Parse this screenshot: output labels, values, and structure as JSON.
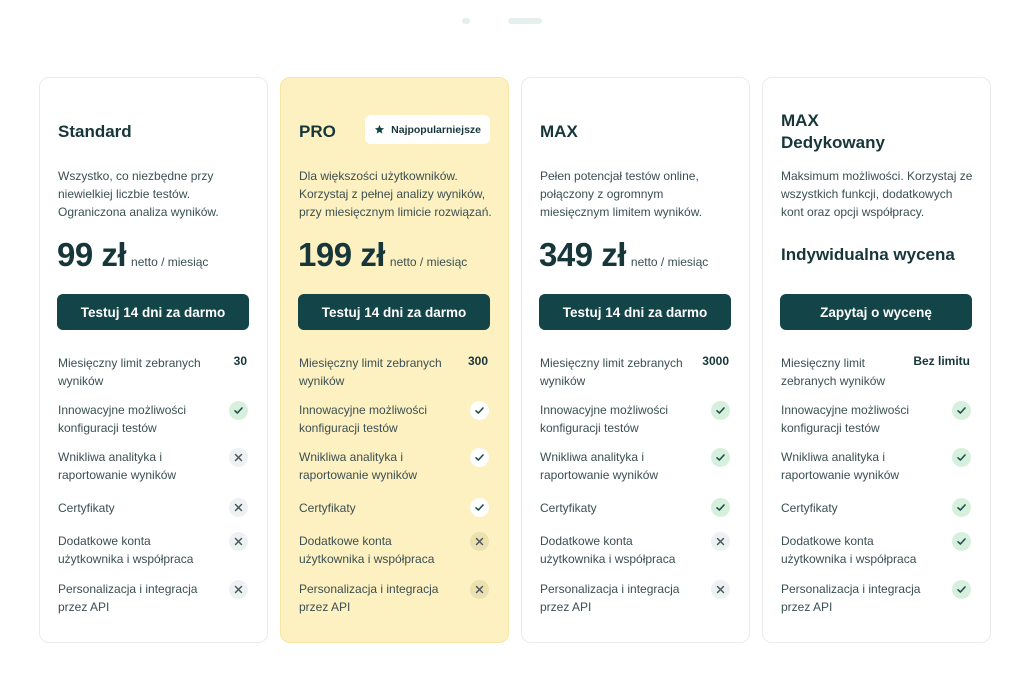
{
  "colors": {
    "primary": "#134447",
    "pro_background": "#fdf1c1",
    "check_background": "#d7f0de",
    "cross_background": "#eef1f2",
    "check_mark": "#1f4f4b"
  },
  "icons": {
    "included": "check-icon",
    "excluded": "cross-icon",
    "badge": "star-icon"
  },
  "plans": [
    {
      "id": "standard",
      "title_lines": [
        "Standard"
      ],
      "badge": "",
      "description": [
        "Wszystko, co niezbędne przy",
        "niewielkiej liczbie testów.",
        "Ograniczona analiza wyników."
      ],
      "price_amount": "99 zł",
      "price_unit": "netto / miesiąc",
      "custom_price": "",
      "cta": "Testuj 14 dni za darmo",
      "features": [
        {
          "label": [
            "Miesięczny limit zebranych",
            "wyników"
          ],
          "value": "30"
        },
        {
          "label": [
            "Innowacyjne możliwości",
            "konfiguracji testów"
          ],
          "included": true
        },
        {
          "label": [
            "Wnikliwa analityka i",
            "raportowanie wyników"
          ],
          "included": false
        },
        {
          "label": [
            "Certyfikaty"
          ],
          "included": false
        },
        {
          "label": [
            "Dodatkowe konta",
            "użytkownika i współpraca"
          ],
          "included": false
        },
        {
          "label": [
            "Personalizacja i integracja",
            "przez API"
          ],
          "included": false
        }
      ]
    },
    {
      "id": "pro",
      "title_lines": [
        "PRO"
      ],
      "badge": "Najpopularniejsze",
      "description": [
        "Dla większości użytkowników.",
        "Korzystaj z pełnej analizy wyników,",
        "przy miesięcznym limicie rozwiązań."
      ],
      "price_amount": "199 zł",
      "price_unit": "netto / miesiąc",
      "custom_price": "",
      "cta": "Testuj 14 dni za darmo",
      "features": [
        {
          "label": [
            "Miesięczny limit zebranych",
            "wyników"
          ],
          "value": "300"
        },
        {
          "label": [
            "Innowacyjne możliwości",
            "konfiguracji testów"
          ],
          "included": true
        },
        {
          "label": [
            "Wnikliwa analityka i",
            "raportowanie wyników"
          ],
          "included": true
        },
        {
          "label": [
            "Certyfikaty"
          ],
          "included": true
        },
        {
          "label": [
            "Dodatkowe konta",
            "użytkownika i współpraca"
          ],
          "included": false
        },
        {
          "label": [
            "Personalizacja i integracja",
            "przez API"
          ],
          "included": false
        }
      ]
    },
    {
      "id": "max",
      "title_lines": [
        "MAX"
      ],
      "badge": "",
      "description": [
        "Pełen potencjał testów online,",
        "połączony z ogromnym",
        "miesięcznym limitem wyników."
      ],
      "price_amount": "349 zł",
      "price_unit": "netto / miesiąc",
      "custom_price": "",
      "cta": "Testuj 14 dni za darmo",
      "features": [
        {
          "label": [
            "Miesięczny limit zebranych",
            "wyników"
          ],
          "value": "3000"
        },
        {
          "label": [
            "Innowacyjne możliwości",
            "konfiguracji testów"
          ],
          "included": true
        },
        {
          "label": [
            "Wnikliwa analityka i",
            "raportowanie wyników"
          ],
          "included": true
        },
        {
          "label": [
            "Certyfikaty"
          ],
          "included": true
        },
        {
          "label": [
            "Dodatkowe konta",
            "użytkownika i współpraca"
          ],
          "included": false
        },
        {
          "label": [
            "Personalizacja i integracja",
            "przez API"
          ],
          "included": false
        }
      ]
    },
    {
      "id": "max-dedicated",
      "title_lines": [
        "MAX",
        "Dedykowany"
      ],
      "badge": "",
      "description": [
        "Maksimum możliwości. Korzystaj ze",
        "wszystkich funkcji, dodatkowych",
        "kont oraz opcji współpracy."
      ],
      "price_amount": "",
      "price_unit": "",
      "custom_price": "Indywidualna wycena",
      "cta": "Zapytaj o wycenę",
      "features": [
        {
          "label": [
            "Miesięczny limit",
            "zebranych wyników"
          ],
          "value": "Bez limitu"
        },
        {
          "label": [
            "Innowacyjne możliwości",
            "konfiguracji testów"
          ],
          "included": true
        },
        {
          "label": [
            "Wnikliwa analityka i",
            "raportowanie wyników"
          ],
          "included": true
        },
        {
          "label": [
            "Certyfikaty"
          ],
          "included": true
        },
        {
          "label": [
            "Dodatkowe konta",
            "użytkownika i współpraca"
          ],
          "included": true
        },
        {
          "label": [
            "Personalizacja i integracja",
            "przez API"
          ],
          "included": true
        }
      ]
    }
  ]
}
